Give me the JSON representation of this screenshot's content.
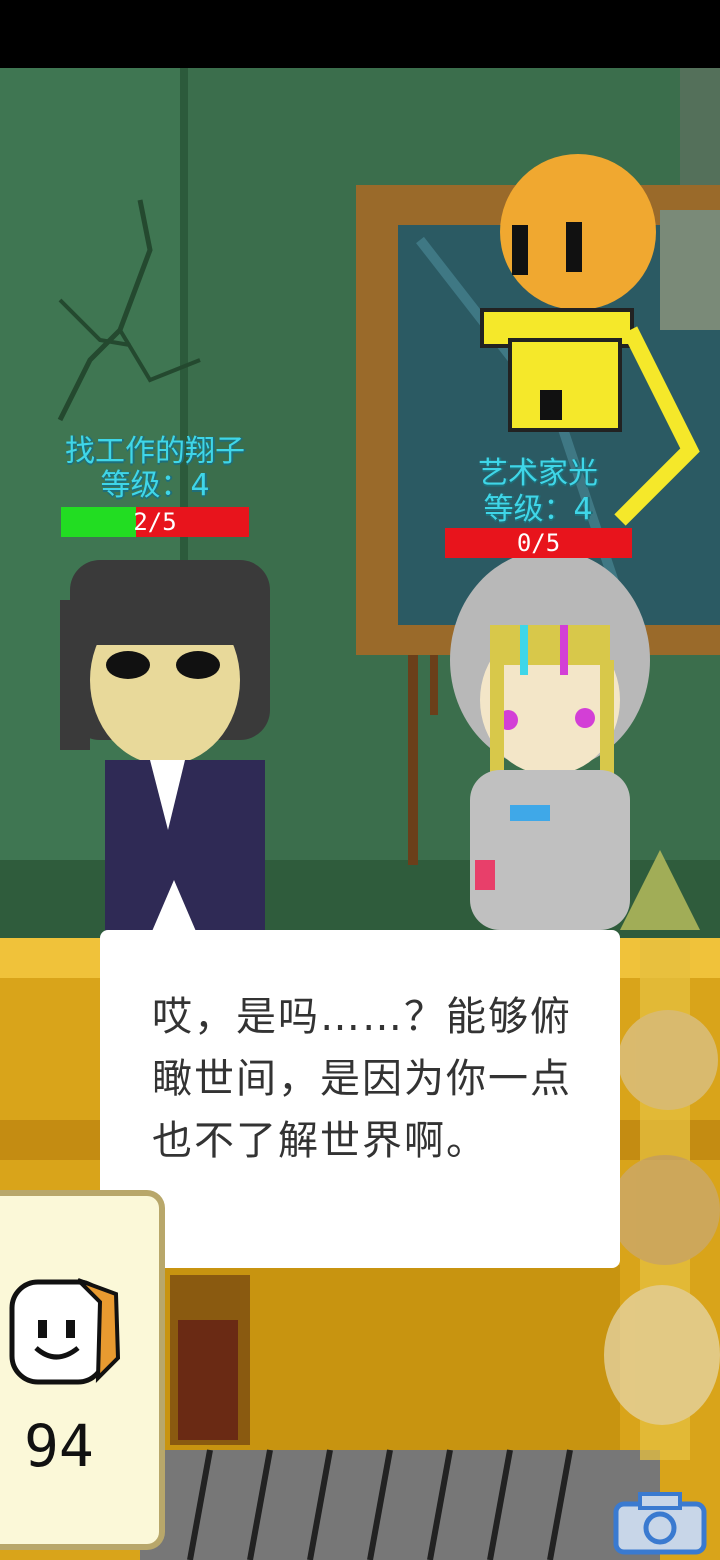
{
  "characters": [
    {
      "name": "找工作的翔子",
      "level_label": "等级：4",
      "hp_text": "2/5",
      "hp_fraction": 0.4
    },
    {
      "name": "艺术家光",
      "level_label": "等级：4",
      "hp_text": "0/5",
      "hp_fraction": 0.0
    }
  ],
  "dialog": {
    "text": "哎，是吗……？能够俯瞰世间，是因为你一点也不了解世界啊。"
  },
  "bread": {
    "count": "94"
  },
  "icons": [
    "bread-icon",
    "camera-icon",
    "scroll-up-arrow-icon",
    "customer-queue-icon"
  ],
  "colors": {
    "wall": "#3a6e4a",
    "counter": "#e0b020",
    "label_cyan": "#3fd6e8",
    "hp_green": "#22dd22",
    "hp_red": "#e8141c"
  }
}
